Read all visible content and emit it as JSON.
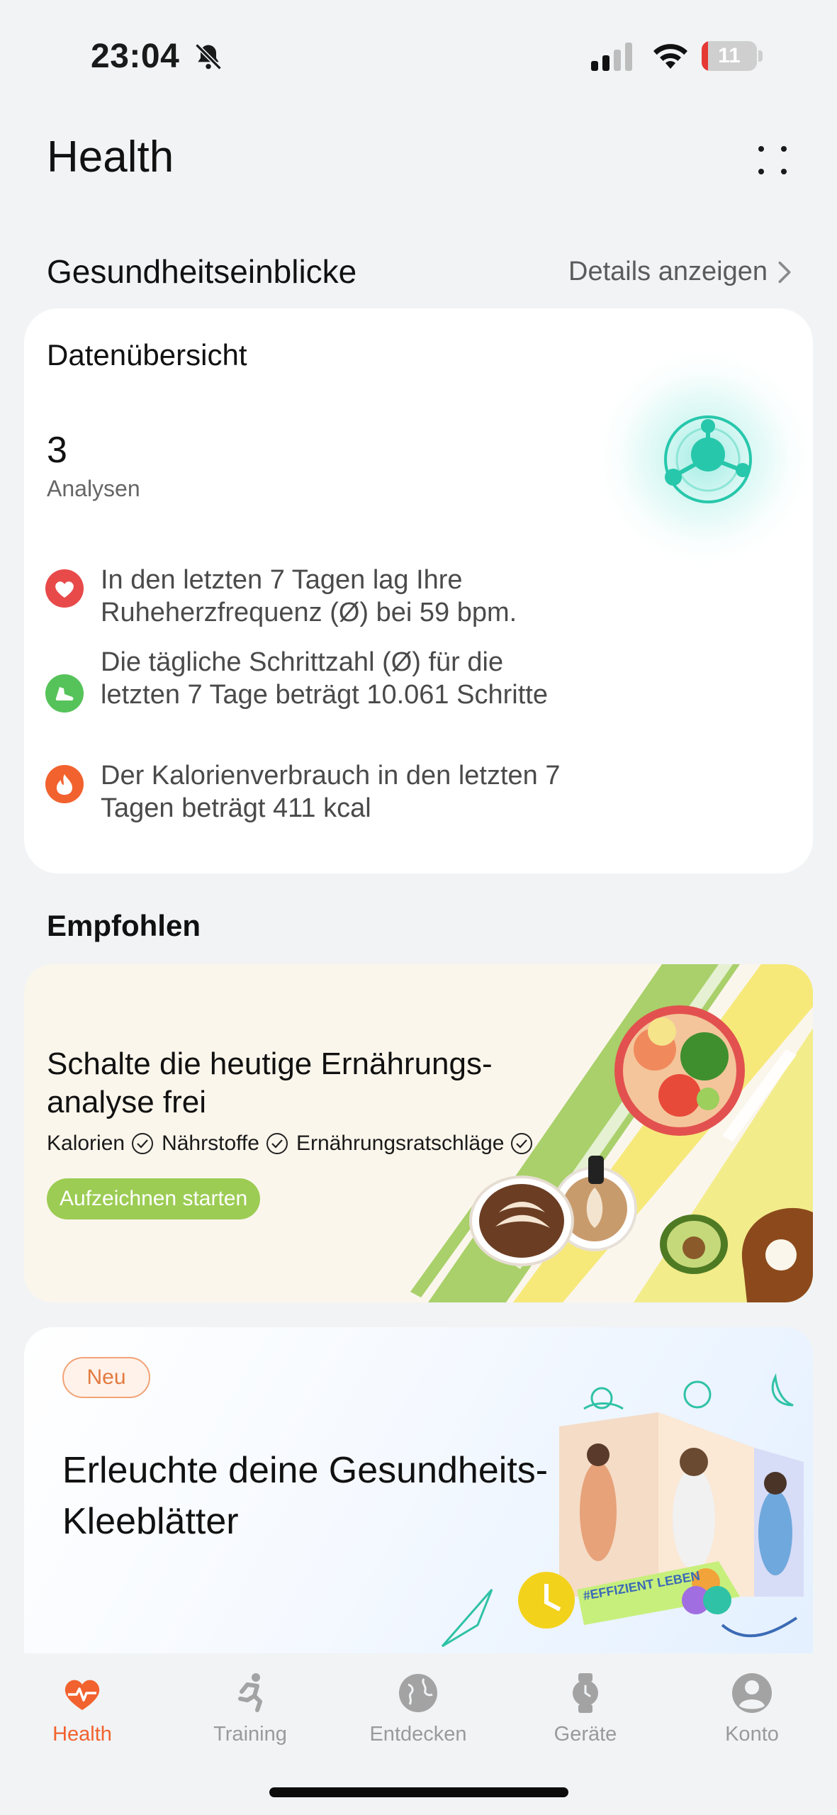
{
  "status_bar": {
    "time": "23:04",
    "battery_level": "11",
    "battery_fraction": 0.11,
    "icons": [
      "bell-off-icon",
      "signal-icon",
      "wifi-icon",
      "battery-icon"
    ]
  },
  "header": {
    "title": "Health",
    "more_icon": "more-dots-icon"
  },
  "insights_section": {
    "title": "Gesundheitseinblicke",
    "details_link": "Details anzeigen"
  },
  "overview_card": {
    "title": "Datenübersicht",
    "count": "3",
    "count_label": "Analysen",
    "insights": [
      {
        "icon": "heart-icon",
        "color": "#e84a4a",
        "text": "In den letzten 7 Tagen lag Ihre Ruheherzfrequenz (Ø) bei 59 bpm."
      },
      {
        "icon": "shoe-icon",
        "color": "#56c35a",
        "text": "Die tägliche Schrittzahl (Ø) für die letzten 7 Tage beträgt 10.061 Schritte"
      },
      {
        "icon": "flame-icon",
        "color": "#f2622e",
        "text": "Der Kalorienverbrauch in den letzten 7 Tagen beträgt 411 kcal"
      }
    ]
  },
  "recommended": {
    "title": "Empfohlen",
    "nutrition_banner": {
      "title": "Schalte die heutige Ernährungs-analyse frei",
      "features": [
        "Kalorien",
        "Nährstoffe",
        "Ernährungsratschläge"
      ],
      "button": "Aufzeichnen starten"
    },
    "clover_banner": {
      "badge": "Neu",
      "title": "Erleuchte deine Gesundheits-Kleeblätter",
      "art_caption": "#EFFIZIENT LEBEN"
    }
  },
  "bottom_nav": {
    "active": "Health",
    "items": [
      {
        "label": "Health",
        "icon": "heart-pulse-icon"
      },
      {
        "label": "Training",
        "icon": "running-icon"
      },
      {
        "label": "Entdecken",
        "icon": "globe-icon"
      },
      {
        "label": "Geräte",
        "icon": "watch-icon"
      },
      {
        "label": "Konto",
        "icon": "account-icon"
      }
    ]
  },
  "colors": {
    "accent": "#f2622e",
    "teal": "#27c7ab",
    "button_green": "#9ccc54",
    "background": "#f1f3f5"
  }
}
